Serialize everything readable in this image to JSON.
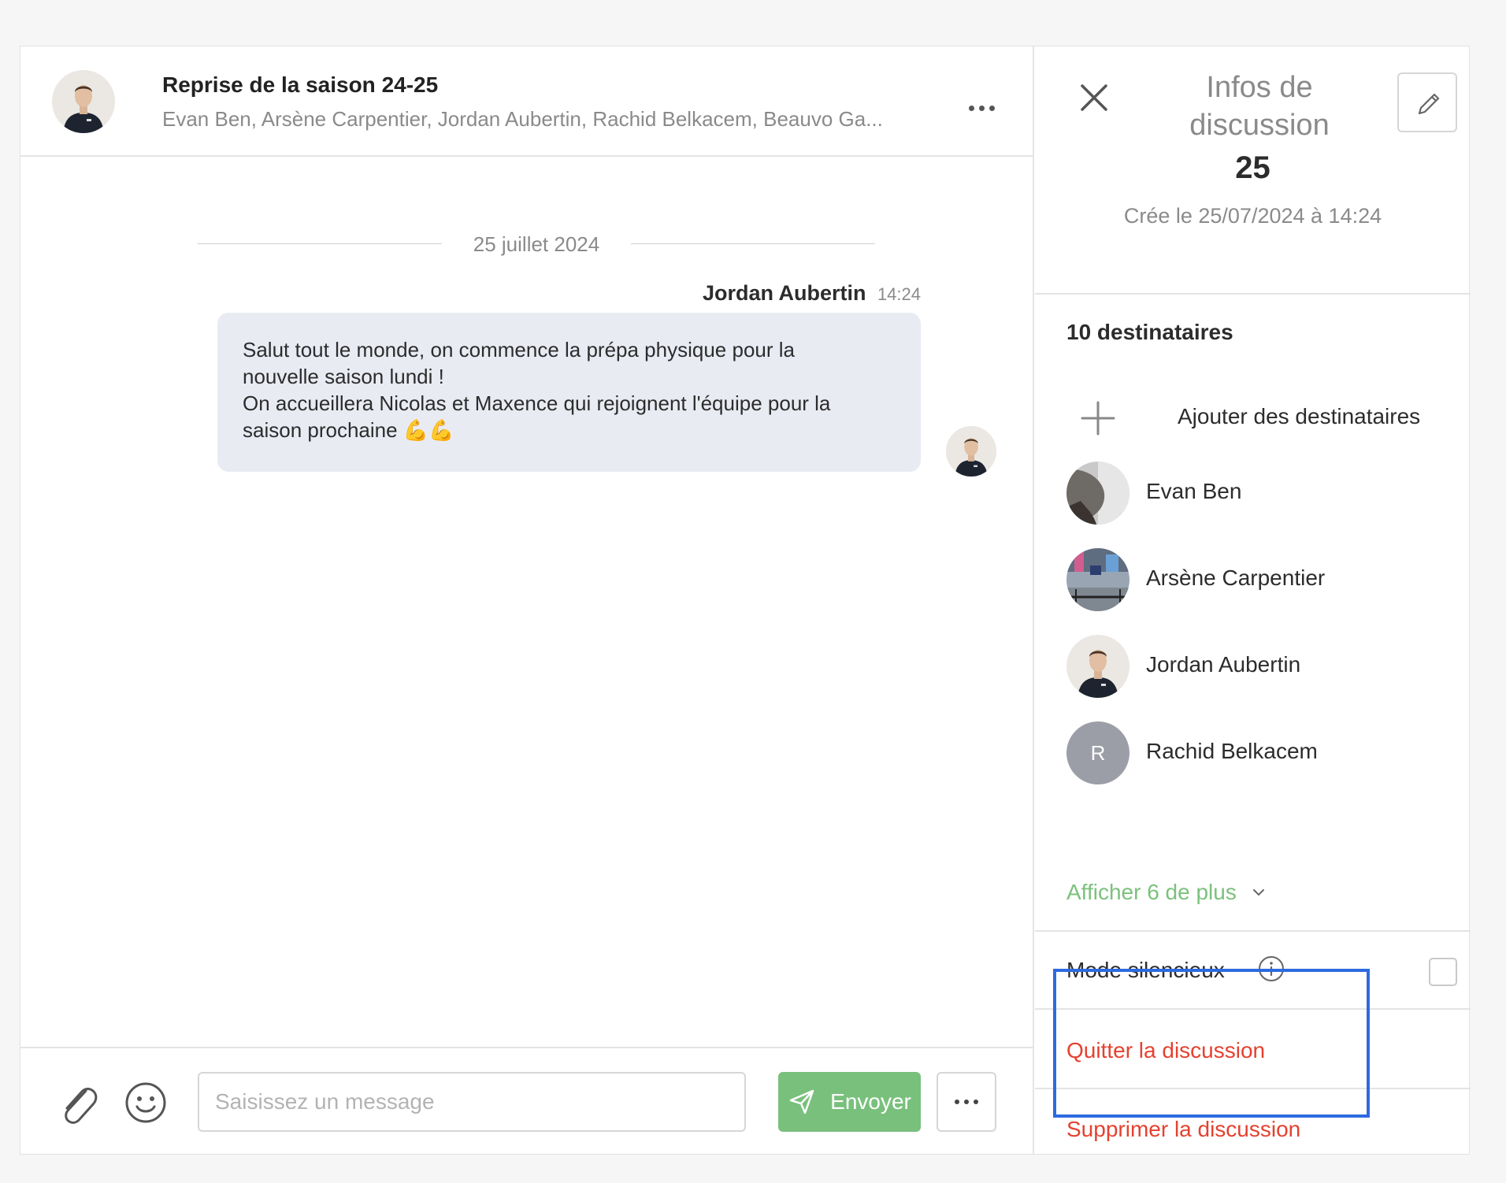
{
  "chat": {
    "title": "Reprise de la saison 24-25",
    "participants_preview": "Evan Ben, Arsène Carpentier, Jordan Aubertin, Rachid Belkacem, Beauvo Ga...",
    "date_separator": "25 juillet 2024",
    "message": {
      "author": "Jordan Aubertin",
      "time": "14:24",
      "lines": [
        "Salut tout le monde, on commence la prépa physique pour la",
        "nouvelle saison lundi !",
        "On accueillera Nicolas et Maxence qui rejoignent l'équipe pour la",
        "saison prochaine 💪💪"
      ]
    },
    "composer": {
      "placeholder": "Saisissez un message",
      "send_label": "Envoyer"
    }
  },
  "info_panel": {
    "title": "Infos de discussion",
    "discussion_name_visible": "25",
    "created": "Crée le 25/07/2024 à 14:24",
    "recipients_count_label": "10 destinataires",
    "add_recipients_label": "Ajouter des destinataires",
    "members": [
      {
        "name": "Evan Ben",
        "avatar": "photo"
      },
      {
        "name": "Arsène Carpentier",
        "avatar": "photo"
      },
      {
        "name": "Jordan Aubertin",
        "avatar": "photo"
      },
      {
        "name": "Rachid Belkacem",
        "avatar": "initial",
        "initial": "R"
      }
    ],
    "show_more_label": "Afficher 6 de plus",
    "silent_mode_label": "Mode silencieux",
    "silent_mode_checked": false,
    "leave_label": "Quitter la discussion",
    "delete_label": "Supprimer la discussion"
  },
  "colors": {
    "accent_green": "#79c07c",
    "danger_red": "#e5412f",
    "highlight_blue": "#2d6ae0",
    "bubble_bg": "#e9ebf3"
  },
  "icons": [
    "avatar-photo",
    "more-dots-icon",
    "paperclip-icon",
    "smiley-icon",
    "send-icon",
    "close-icon",
    "pencil-icon",
    "plus-icon",
    "chevron-down-icon",
    "info-icon"
  ]
}
